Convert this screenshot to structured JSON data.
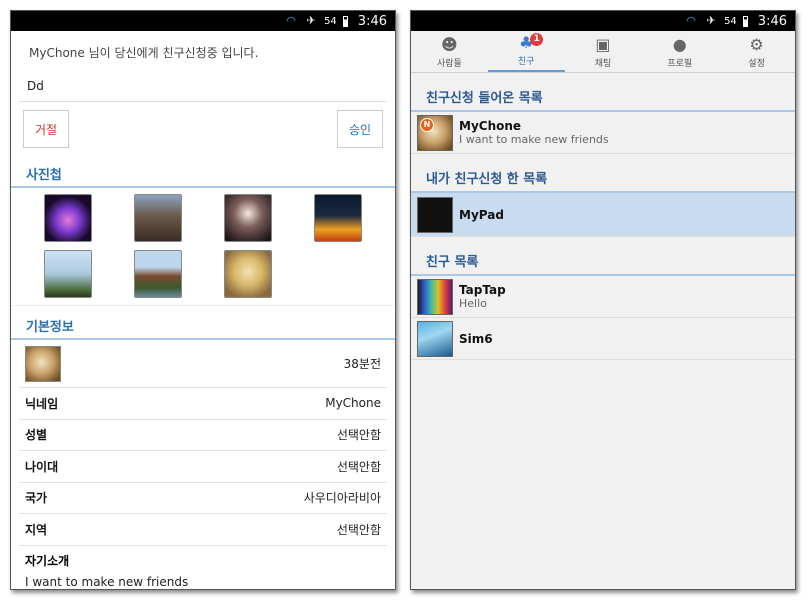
{
  "status_bar": {
    "signal": "54",
    "time": "3:46"
  },
  "left": {
    "request_message": "MyChone 님이 당신에게 친구신청중 입니다.",
    "request_note": "Dd",
    "reject_label": "거절",
    "accept_label": "승인",
    "album_title": "사진첩",
    "basic_info_title": "기본정보",
    "last_seen": "38분전",
    "info": [
      {
        "key": "닉네임",
        "value": "MyChone"
      },
      {
        "key": "성별",
        "value": "선택안함"
      },
      {
        "key": "나이대",
        "value": "선택안함"
      },
      {
        "key": "국가",
        "value": "사우디아라비아"
      },
      {
        "key": "지역",
        "value": "선택안함"
      }
    ],
    "intro_key": "자기소개",
    "intro_value": "I want to make new friends"
  },
  "right": {
    "tabs": [
      {
        "label": "사람들",
        "icon": "people-icon"
      },
      {
        "label": "친구",
        "icon": "friends-icon",
        "badge": "1"
      },
      {
        "label": "채팅",
        "icon": "chat-icon"
      },
      {
        "label": "프로필",
        "icon": "profile-icon"
      },
      {
        "label": "설정",
        "icon": "gear-icon"
      }
    ],
    "received_title": "친구신청 들어온 목록",
    "received": [
      {
        "name": "MyChone",
        "status": "I want to make new friends",
        "badge": "N"
      }
    ],
    "sent_title": "내가 친구신청 한 목록",
    "sent": [
      {
        "name": "MyPad"
      }
    ],
    "friends_title": "친구 목록",
    "friends": [
      {
        "name": "TapTap",
        "status": "Hello"
      },
      {
        "name": "Sim6"
      }
    ]
  },
  "colors": {
    "accent": "#2a6fb0",
    "reject": "#c0392b",
    "badge": "#e23b3b",
    "selected_row": "#c9dbee"
  }
}
